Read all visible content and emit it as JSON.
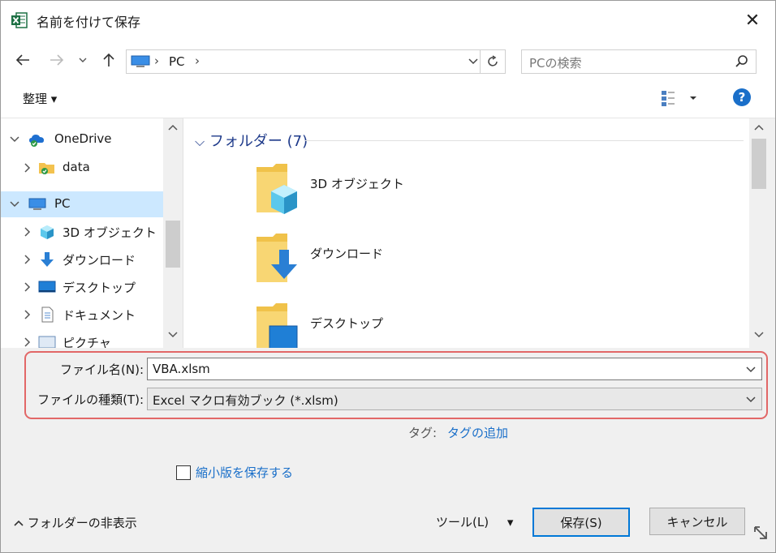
{
  "window": {
    "title": "名前を付けて保存",
    "close_glyph": "✕"
  },
  "nav": {
    "breadcrumb": [
      "PC"
    ],
    "search_placeholder": "PCの検索"
  },
  "toolbar": {
    "organize_label": "整理 ▾"
  },
  "tree": [
    {
      "label": "OneDrive",
      "icon": "onedrive-icon",
      "indent": 0,
      "expanded": true,
      "selected": false
    },
    {
      "label": "data",
      "icon": "folder-icon",
      "indent": 1,
      "expanded": false,
      "selected": false
    },
    {
      "label": "PC",
      "icon": "pc-icon",
      "indent": 0,
      "expanded": true,
      "selected": true
    },
    {
      "label": "3D オブジェクト",
      "icon": "3d-objects-icon",
      "indent": 1,
      "expanded": false,
      "selected": false
    },
    {
      "label": "ダウンロード",
      "icon": "download-icon",
      "indent": 1,
      "expanded": false,
      "selected": false
    },
    {
      "label": "デスクトップ",
      "icon": "desktop-icon",
      "indent": 1,
      "expanded": false,
      "selected": false
    },
    {
      "label": "ドキュメント",
      "icon": "document-icon",
      "indent": 1,
      "expanded": false,
      "selected": false
    },
    {
      "label": "ピクチャ",
      "icon": "pictures-icon",
      "indent": 1,
      "expanded": false,
      "selected": false
    }
  ],
  "content": {
    "group_header": "フォルダー (7)",
    "items": [
      {
        "label": "3D オブジェクト",
        "icon": "3d-objects-folder-icon"
      },
      {
        "label": "ダウンロード",
        "icon": "download-folder-icon"
      },
      {
        "label": "デスクトップ",
        "icon": "desktop-folder-icon"
      }
    ]
  },
  "form": {
    "filename_label": "ファイル名(N):",
    "filename_value": "VBA.xlsm",
    "filetype_label": "ファイルの種類(T):",
    "filetype_value": "Excel マクロ有効ブック (*.xlsm)",
    "tags_label": "タグ:",
    "tags_link": "タグの追加",
    "thumbnail_label": "縮小版を保存する",
    "thumbnail_checked": false
  },
  "footer": {
    "hide_folders_label": "フォルダーの非表示",
    "tools_label": "ツール(L)",
    "save_label": "保存(S)",
    "cancel_label": "キャンセル"
  },
  "colors": {
    "accent": "#1a6fc9",
    "selection": "#cce8ff",
    "highlight_border": "#e26767",
    "excel_green": "#1d7044"
  }
}
